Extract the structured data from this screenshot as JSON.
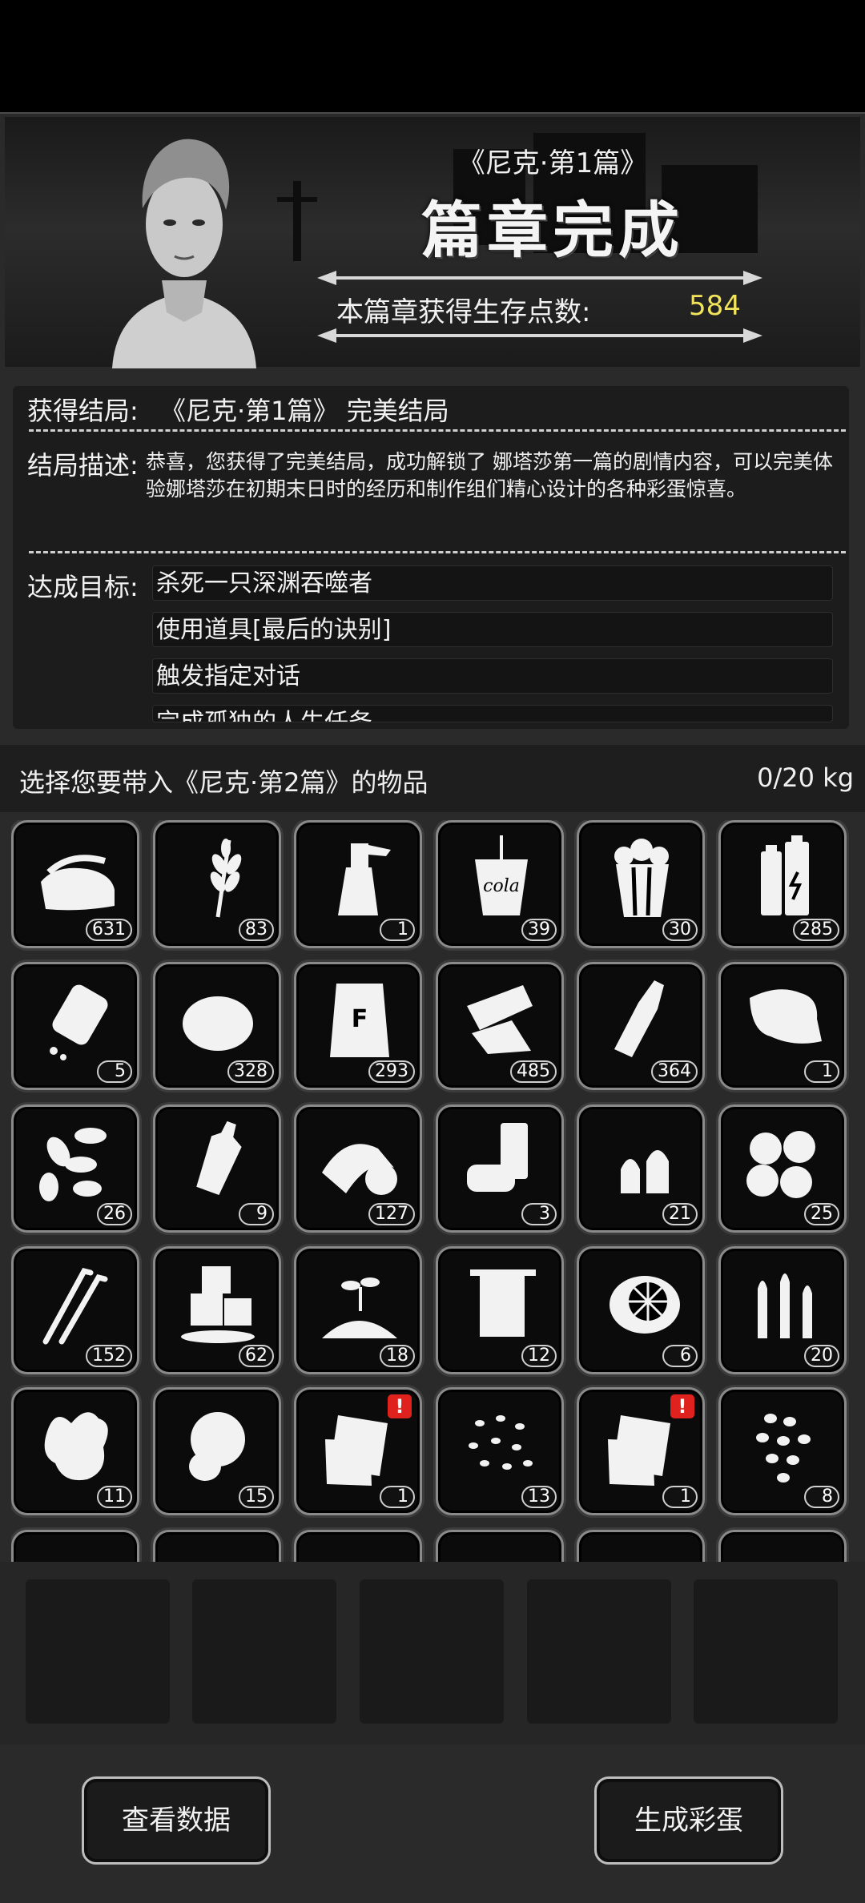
{
  "header": {
    "chapter_subtitle": "《尼克·第1篇》",
    "chapter_title": "篇章完成",
    "points_label": "本篇章获得生存点数:",
    "points_value": "584",
    "points_color": "#f1e45a"
  },
  "ending": {
    "label": "获得结局:",
    "name": "《尼克·第1篇》  完美结局",
    "desc_label": "结局描述:",
    "description": "恭喜，您获得了完美结局，成功解锁了 娜塔莎第一篇的剧情内容，可以完美体验娜塔莎在初期末日时的经历和制作组们精心设计的各种彩蛋惊喜。",
    "goals_label": "达成目标:",
    "goals": [
      "杀死一只深渊吞噬者",
      "使用道具[最后的诀别]",
      "触发指定对话",
      "完成孤独的人生任务"
    ]
  },
  "items_section": {
    "title": "选择您要带入《尼克·第2篇》的物品",
    "weight": "0/20 kg"
  },
  "items": [
    {
      "icon": "cloth-icon",
      "count": "631"
    },
    {
      "icon": "wheat-icon",
      "count": "83"
    },
    {
      "icon": "spray-bottle-icon",
      "count": "1"
    },
    {
      "icon": "cola-cup-icon",
      "count": "39",
      "text": "cola"
    },
    {
      "icon": "popcorn-icon",
      "count": "30"
    },
    {
      "icon": "battery-icon",
      "count": "285"
    },
    {
      "icon": "pill-bottle-icon",
      "count": "5"
    },
    {
      "icon": "fiber-ball-icon",
      "count": "328"
    },
    {
      "icon": "flour-bag-icon",
      "count": "293",
      "text": "F"
    },
    {
      "icon": "scrap-metal-icon",
      "count": "485"
    },
    {
      "icon": "glass-bottle-icon",
      "count": "364"
    },
    {
      "icon": "leather-icon",
      "count": "1"
    },
    {
      "icon": "seeds-icon",
      "count": "26"
    },
    {
      "icon": "plastic-bottle-icon",
      "count": "9"
    },
    {
      "icon": "tape-icon",
      "count": "127"
    },
    {
      "icon": "cans-icon",
      "count": "3"
    },
    {
      "icon": "bullet-tips-icon",
      "count": "21"
    },
    {
      "icon": "cotton-icon",
      "count": "25"
    },
    {
      "icon": "wire-tools-icon",
      "count": "152"
    },
    {
      "icon": "ice-cubes-icon",
      "count": "62"
    },
    {
      "icon": "sprout-soil-icon",
      "count": "18"
    },
    {
      "icon": "towel-icon",
      "count": "12"
    },
    {
      "icon": "fan-part-icon",
      "count": "6"
    },
    {
      "icon": "ammo-icon",
      "count": "20"
    },
    {
      "icon": "ginger-icon",
      "count": "11"
    },
    {
      "icon": "lettuce-icon",
      "count": "15"
    },
    {
      "icon": "paper-note-icon",
      "count": "1",
      "alert": "!"
    },
    {
      "icon": "rice-icon",
      "count": "13"
    },
    {
      "icon": "paper-note-icon",
      "count": "1",
      "alert": "!"
    },
    {
      "icon": "beans-icon",
      "count": "8"
    }
  ],
  "buttons": {
    "view_data": "查看数据",
    "generate_egg": "生成彩蛋"
  }
}
